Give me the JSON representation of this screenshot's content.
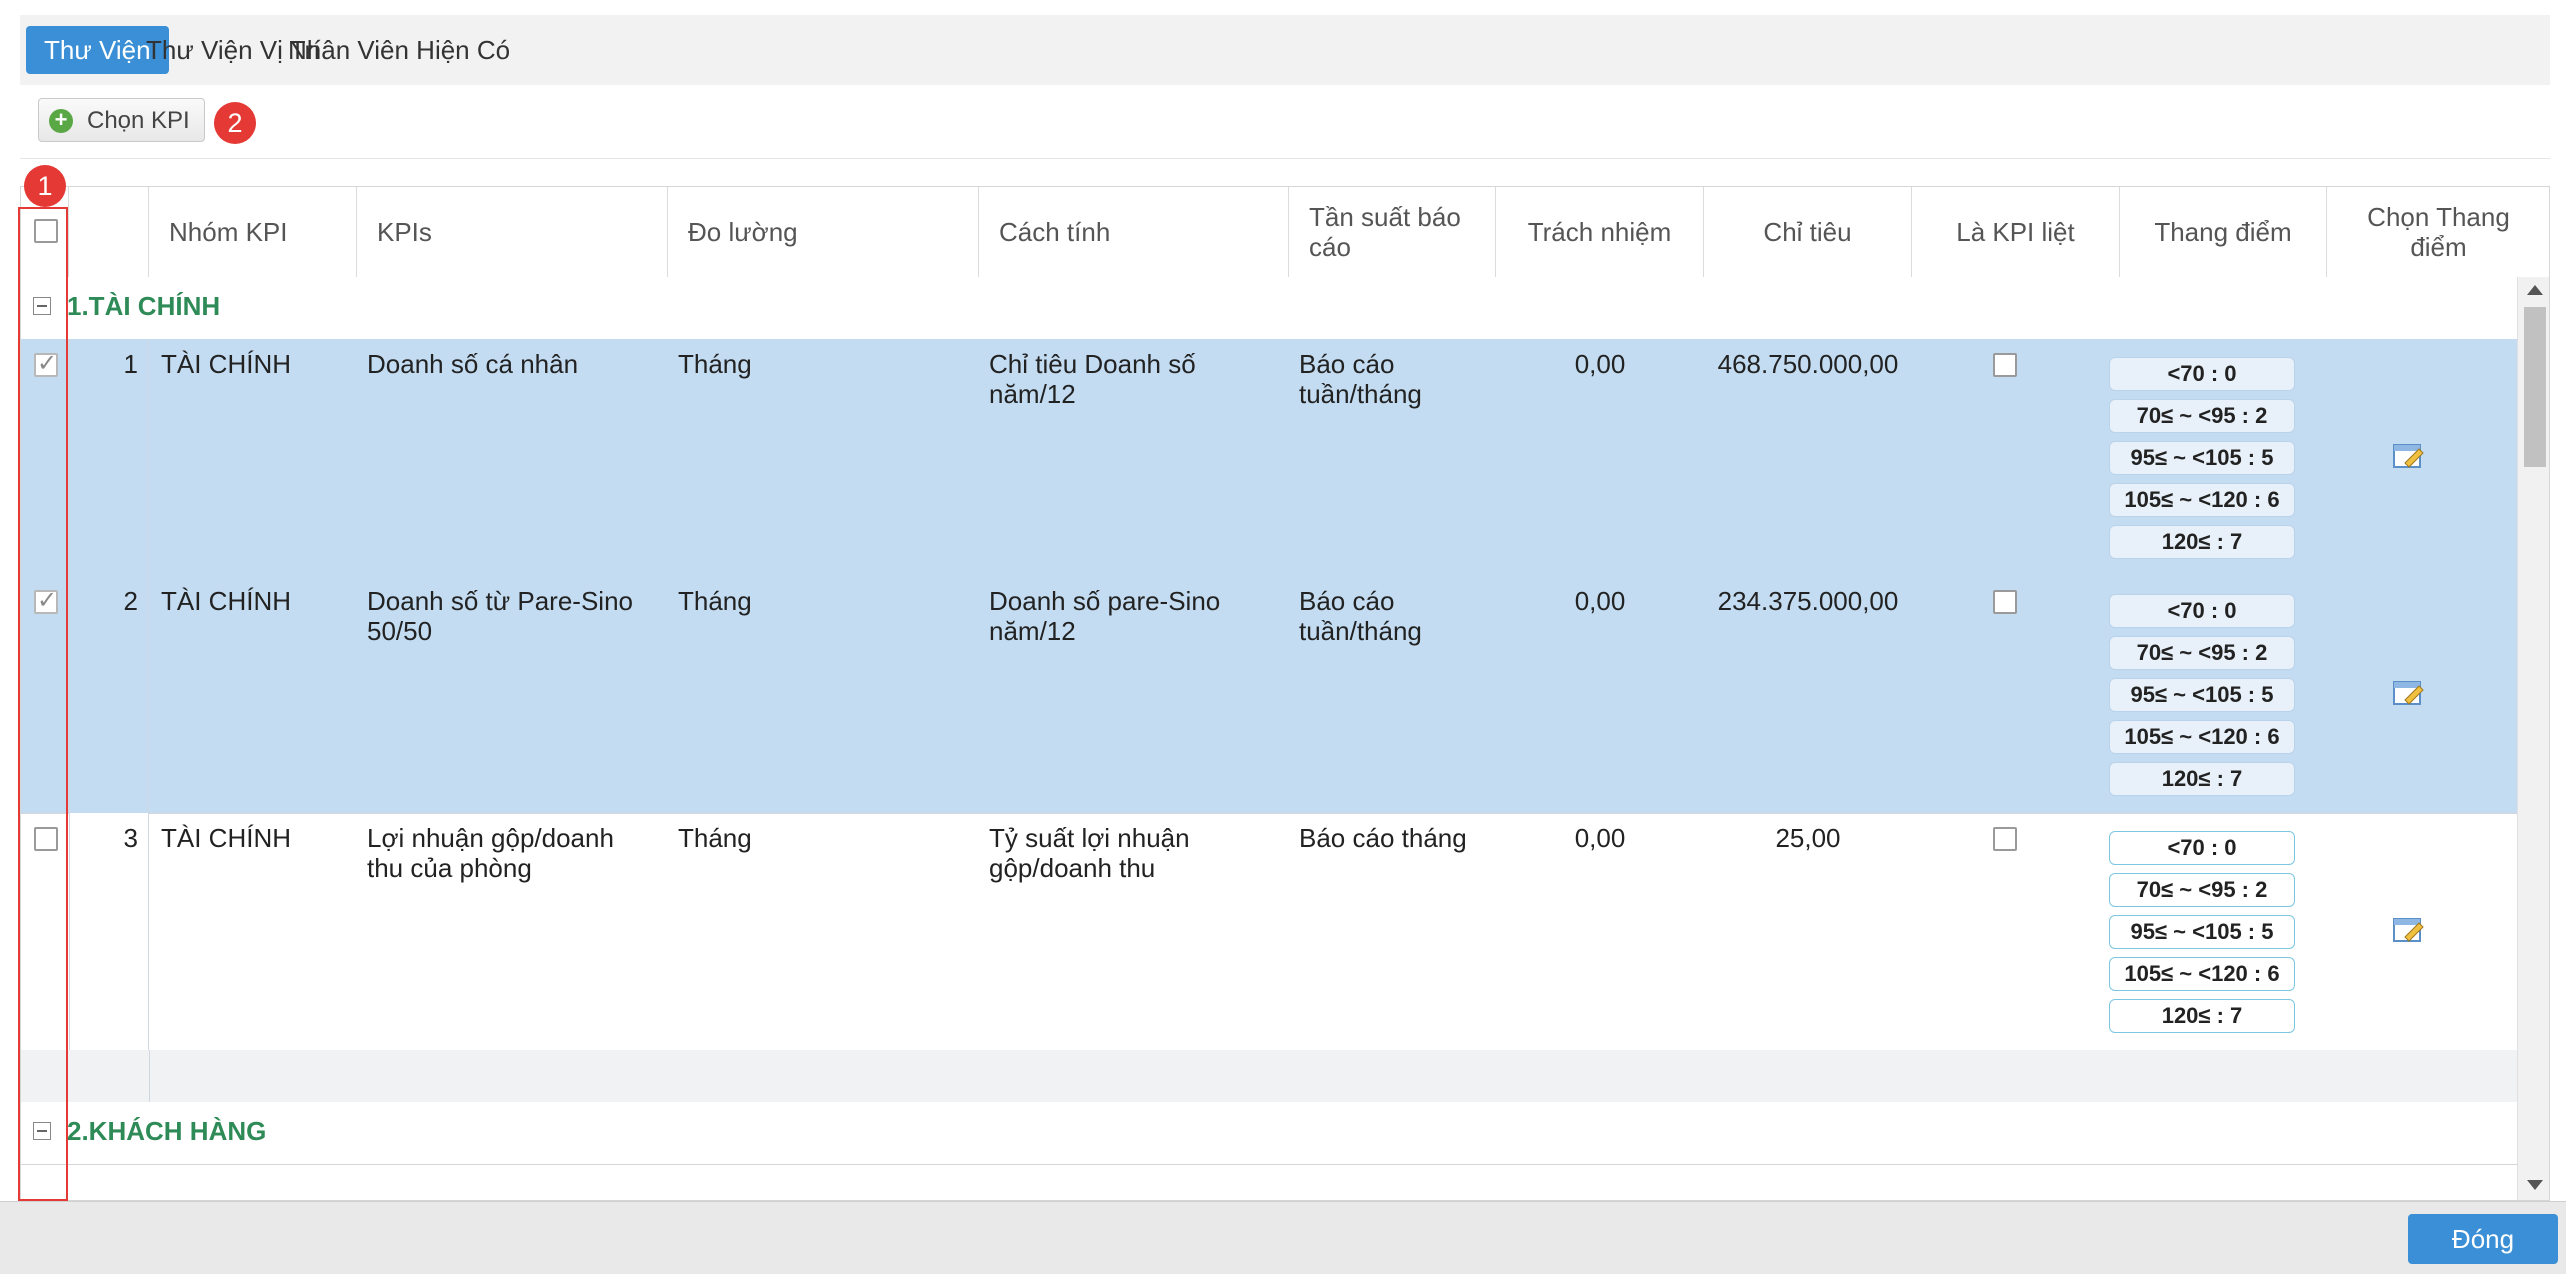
{
  "tabs": [
    {
      "label": "Thư Viện",
      "active": true
    },
    {
      "label": "Thư Viện Vị Trí",
      "active": false
    },
    {
      "label": "Nhân Viên Hiện Có",
      "active": false
    }
  ],
  "toolbar": {
    "choose_kpi_label": "Chọn KPI",
    "badge": "2"
  },
  "annotation_badge": "1",
  "columns": {
    "group": "Nhóm KPI",
    "kpis": "KPIs",
    "measure": "Đo lường",
    "method": "Cách tính",
    "frequency": "Tần suất báo cáo",
    "responsibility": "Trách nhiệm",
    "target": "Chỉ tiêu",
    "critical": "Là KPI liệt",
    "scale": "Thang điểm",
    "choose_scale": "Chọn Thang điểm"
  },
  "groups": [
    {
      "label": "1.TÀI CHÍNH"
    },
    {
      "label": "2.KHÁCH HÀNG"
    }
  ],
  "rows": [
    {
      "no": "1",
      "group": "TÀI CHÍNH",
      "kpi": "Doanh số cá nhân",
      "measure": "Tháng",
      "method": "Chỉ tiêu Doanh số năm/12",
      "frequency": "Báo cáo tuần/tháng",
      "responsibility": "0,00",
      "target": "468.750.000,00",
      "selected": true,
      "scale": [
        "<70 : 0",
        "70≤ ~ <95 : 2",
        "95≤ ~ <105 : 5",
        "105≤ ~ <120 : 6",
        "120≤ : 7"
      ]
    },
    {
      "no": "2",
      "group": "TÀI CHÍNH",
      "kpi": "Doanh số từ Pare-Sino 50/50",
      "measure": "Tháng",
      "method": "Doanh số pare-Sino năm/12",
      "frequency": "Báo cáo tuần/tháng",
      "responsibility": "0,00",
      "target": "234.375.000,00",
      "selected": true,
      "scale": [
        "<70 : 0",
        "70≤ ~ <95 : 2",
        "95≤ ~ <105 : 5",
        "105≤ ~ <120 : 6",
        "120≤ : 7"
      ]
    },
    {
      "no": "3",
      "group": "TÀI CHÍNH",
      "kpi": "Lợi nhuận gộp/doanh thu của phòng",
      "measure": "Tháng",
      "method": "Tỷ suất lợi nhuận gộp/doanh thu",
      "frequency": "Báo cáo tháng",
      "responsibility": "0,00",
      "target": "25,00",
      "selected": false,
      "scale": [
        "<70 : 0",
        "70≤ ~ <95 : 2",
        "95≤ ~ <105 : 5",
        "105≤ ~ <120 : 6",
        "120≤ : 7"
      ]
    }
  ],
  "footer": {
    "close_label": "Đóng"
  },
  "colors": {
    "accent": "#3a8fd6",
    "selected_row": "#c3dcf1",
    "group_text": "#2e8b57",
    "annotation": "#e53935"
  }
}
